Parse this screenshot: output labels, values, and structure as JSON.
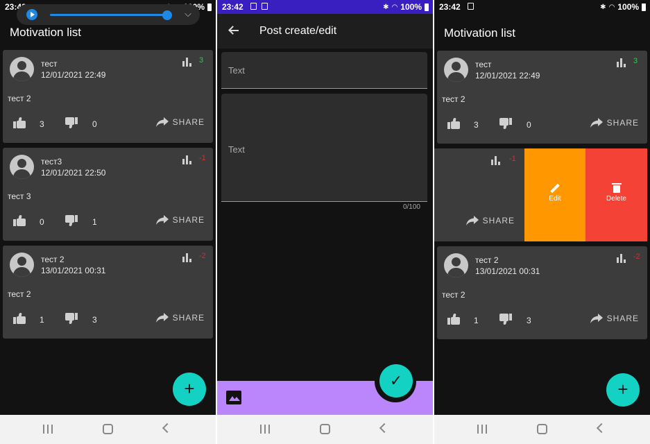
{
  "screen1": {
    "status_time": "23:42",
    "battery": "100%",
    "title": "Motivation list",
    "cards": [
      {
        "name": "тест",
        "date": "12/01/2021 22:49",
        "rating": "3",
        "text": "тест 2",
        "likes": "3",
        "dislikes": "0"
      },
      {
        "name": "тест3",
        "date": "12/01/2021 22:50",
        "rating": "-1",
        "text": "тест 3",
        "likes": "0",
        "dislikes": "1"
      },
      {
        "name": "тест 2",
        "date": "13/01/2021 00:31",
        "rating": "-2",
        "text": "тест 2",
        "likes": "1",
        "dislikes": "3"
      }
    ],
    "share_label": "SHARE",
    "fab_label": "+"
  },
  "screen2": {
    "status_time": "23:42",
    "battery": "100%",
    "title": "Post create/edit",
    "title_placeholder": "Text",
    "body_placeholder": "Text",
    "counter": "0/100",
    "fab_label": "✓"
  },
  "screen3": {
    "status_time": "23:42",
    "battery": "100%",
    "title": "Motivation list",
    "cards": [
      {
        "name": "тест",
        "date": "12/01/2021 22:49",
        "rating": "3",
        "text": "тест 2",
        "likes": "3",
        "dislikes": "0"
      },
      {
        "rating": "-1"
      },
      {
        "name": "тест 2",
        "date": "13/01/2021 00:31",
        "rating": "-2",
        "text": "тест 2",
        "likes": "1",
        "dislikes": "3"
      }
    ],
    "share_label": "SHARE",
    "edit_label": "Edit",
    "delete_label": "Delete",
    "fab_label": "+"
  },
  "colors": {
    "fab": "#14d2c3",
    "bottom_bar": "#bb86fc",
    "positive": "#2ecc40",
    "negative": "#d32f2f",
    "edit": "#ff9800",
    "delete": "#f44336"
  }
}
